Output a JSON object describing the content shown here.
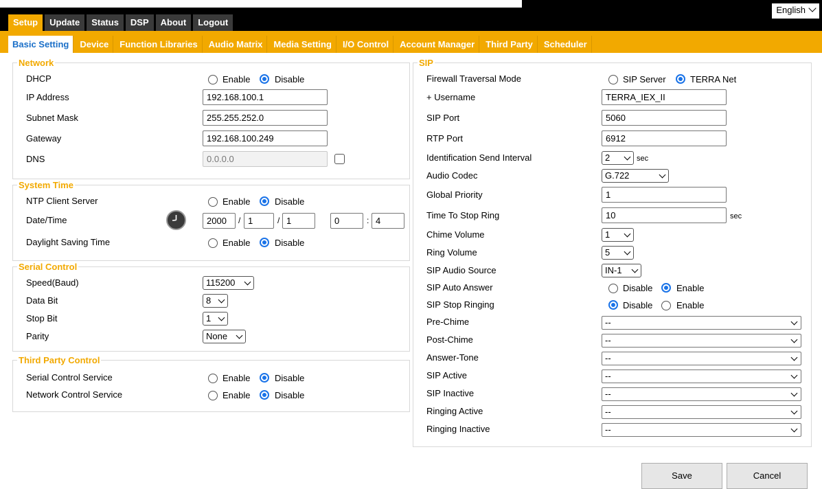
{
  "language": "English",
  "main_tabs": [
    "Setup",
    "Update",
    "Status",
    "DSP",
    "About",
    "Logout"
  ],
  "sub_tabs": [
    "Basic Setting",
    "Device",
    "Function Libraries",
    "Audio Matrix",
    "Media Setting",
    "I/O Control",
    "Account Manager",
    "Third Party",
    "Scheduler"
  ],
  "enable": "Enable",
  "disable": "Disable",
  "network": {
    "legend": "Network",
    "dhcp": "DHCP",
    "ip_label": "IP Address",
    "ip_value": "192.168.100.1",
    "subnet_label": "Subnet Mask",
    "subnet_value": "255.255.252.0",
    "gateway_label": "Gateway",
    "gateway_value": "192.168.100.249",
    "dns_label": "DNS",
    "dns_value": "0.0.0.0"
  },
  "system_time": {
    "legend": "System Time",
    "ntp": "NTP Client Server",
    "datetime": "Date/Time",
    "year": "2000",
    "month": "1",
    "day": "1",
    "hour": "0",
    "minute": "4",
    "slash": "/",
    "colon": ":",
    "dst": "Daylight Saving Time"
  },
  "serial": {
    "legend": "Serial Control",
    "speed_label": "Speed(Baud)",
    "speed_value": "115200",
    "databit_label": "Data Bit",
    "databit_value": "8",
    "stopbit_label": "Stop Bit",
    "stopbit_value": "1",
    "parity_label": "Parity",
    "parity_value": "None"
  },
  "third_party": {
    "legend": "Third Party Control",
    "serial_service": "Serial Control Service",
    "network_service": "Network Control Service"
  },
  "sip": {
    "legend": "SIP",
    "firewall_label": "Firewall Traversal Mode",
    "opt_sip_server": "SIP Server",
    "opt_terra_net": "TERRA Net",
    "username_label": "+ Username",
    "username_value": "TERRA_IEX_II",
    "sip_port_label": "SIP Port",
    "sip_port_value": "5060",
    "rtp_port_label": "RTP Port",
    "rtp_port_value": "6912",
    "id_interval_label": "Identification Send Interval",
    "id_interval_value": "2",
    "sec": "sec",
    "codec_label": "Audio Codec",
    "codec_value": "G.722",
    "priority_label": "Global Priority",
    "priority_value": "1",
    "stop_ring_label": "Time To Stop Ring",
    "stop_ring_value": "10",
    "chime_vol_label": "Chime Volume",
    "chime_vol_value": "1",
    "ring_vol_label": "Ring Volume",
    "ring_vol_value": "5",
    "audio_src_label": "SIP Audio Source",
    "audio_src_value": "IN-1",
    "auto_answer_label": "SIP Auto Answer",
    "stop_ringing_label": "SIP Stop Ringing",
    "pre_chime_label": "Pre-Chime",
    "post_chime_label": "Post-Chime",
    "answer_tone_label": "Answer-Tone",
    "sip_active_label": "SIP Active",
    "sip_inactive_label": "SIP Inactive",
    "ringing_active_label": "Ringing Active",
    "ringing_inactive_label": "Ringing Inactive",
    "dash": "--"
  },
  "buttons": {
    "save": "Save",
    "cancel": "Cancel"
  }
}
